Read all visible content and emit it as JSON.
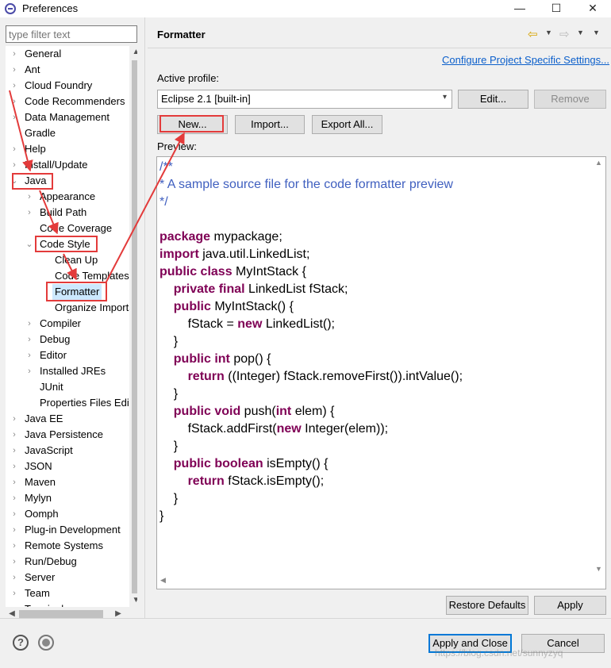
{
  "window": {
    "title": "Preferences",
    "app_icon": "eclipse-icon",
    "min": "—",
    "max": "☐",
    "close": "✕"
  },
  "filter": {
    "placeholder": "type filter text"
  },
  "tree": [
    {
      "label": "General",
      "level": 0,
      "arrow": "›"
    },
    {
      "label": "Ant",
      "level": 0,
      "arrow": "›"
    },
    {
      "label": "Cloud Foundry",
      "level": 0,
      "arrow": "›"
    },
    {
      "label": "Code Recommenders",
      "level": 0,
      "arrow": "›"
    },
    {
      "label": "Data Management",
      "level": 0,
      "arrow": "›"
    },
    {
      "label": "Gradle",
      "level": 0,
      "arrow": ""
    },
    {
      "label": "Help",
      "level": 0,
      "arrow": "›"
    },
    {
      "label": "Install/Update",
      "level": 0,
      "arrow": "›"
    },
    {
      "label": "Java",
      "level": 0,
      "arrow": "⌄"
    },
    {
      "label": "Appearance",
      "level": 1,
      "arrow": "›"
    },
    {
      "label": "Build Path",
      "level": 1,
      "arrow": "›"
    },
    {
      "label": "Code Coverage",
      "level": 1,
      "arrow": ""
    },
    {
      "label": "Code Style",
      "level": 1,
      "arrow": "⌄"
    },
    {
      "label": "Clean Up",
      "level": 2,
      "arrow": ""
    },
    {
      "label": "Code Templates",
      "level": 2,
      "arrow": ""
    },
    {
      "label": "Formatter",
      "level": 2,
      "arrow": "",
      "selected": true
    },
    {
      "label": "Organize Imports",
      "level": 2,
      "arrow": ""
    },
    {
      "label": "Compiler",
      "level": 1,
      "arrow": "›"
    },
    {
      "label": "Debug",
      "level": 1,
      "arrow": "›"
    },
    {
      "label": "Editor",
      "level": 1,
      "arrow": "›"
    },
    {
      "label": "Installed JREs",
      "level": 1,
      "arrow": "›"
    },
    {
      "label": "JUnit",
      "level": 1,
      "arrow": ""
    },
    {
      "label": "Properties Files Editor",
      "level": 1,
      "arrow": ""
    },
    {
      "label": "Java EE",
      "level": 0,
      "arrow": "›"
    },
    {
      "label": "Java Persistence",
      "level": 0,
      "arrow": "›"
    },
    {
      "label": "JavaScript",
      "level": 0,
      "arrow": "›"
    },
    {
      "label": "JSON",
      "level": 0,
      "arrow": "›"
    },
    {
      "label": "Maven",
      "level": 0,
      "arrow": "›"
    },
    {
      "label": "Mylyn",
      "level": 0,
      "arrow": "›"
    },
    {
      "label": "Oomph",
      "level": 0,
      "arrow": "›"
    },
    {
      "label": "Plug-in Development",
      "level": 0,
      "arrow": "›"
    },
    {
      "label": "Remote Systems",
      "level": 0,
      "arrow": "›"
    },
    {
      "label": "Run/Debug",
      "level": 0,
      "arrow": "›"
    },
    {
      "label": "Server",
      "level": 0,
      "arrow": "›"
    },
    {
      "label": "Team",
      "level": 0,
      "arrow": "›"
    },
    {
      "label": "Terminal",
      "level": 0,
      "arrow": "›"
    }
  ],
  "scroll": {
    "up": "▲",
    "down": "▼",
    "left": "◀",
    "right": "▶"
  },
  "page": {
    "title": "Formatter",
    "nav": {
      "back": "⇦",
      "forward": "⇨",
      "dropdown": "▼"
    },
    "configure_link": "Configure Project Specific Settings...",
    "profile_label": "Active profile:",
    "profile_value": "Eclipse 2.1 [built-in]",
    "profile_dd": "▾",
    "buttons": {
      "edit": "Edit...",
      "remove": "Remove",
      "new": "New...",
      "import": "Import...",
      "export_all": "Export All..."
    },
    "preview_label": "Preview:",
    "code": [
      [
        {
          "t": "/**",
          "s": "c"
        }
      ],
      [
        {
          "t": "* A sample source file for the code formatter preview",
          "s": "c"
        }
      ],
      [
        {
          "t": "*/",
          "s": "c"
        }
      ],
      [],
      [
        {
          "t": "package",
          "s": "k"
        },
        {
          "t": " mypackage;"
        }
      ],
      [
        {
          "t": "import",
          "s": "k"
        },
        {
          "t": " java.util.LinkedList;"
        }
      ],
      [
        {
          "t": "public class",
          "s": "k"
        },
        {
          "t": " MyIntStack {"
        }
      ],
      [
        {
          "t": "    "
        },
        {
          "t": "private final",
          "s": "k"
        },
        {
          "t": " LinkedList fStack;"
        }
      ],
      [
        {
          "t": "    "
        },
        {
          "t": "public",
          "s": "k"
        },
        {
          "t": " MyIntStack() {"
        }
      ],
      [
        {
          "t": "        fStack = "
        },
        {
          "t": "new",
          "s": "k"
        },
        {
          "t": " LinkedList();"
        }
      ],
      [
        {
          "t": "    }"
        }
      ],
      [
        {
          "t": "    "
        },
        {
          "t": "public int",
          "s": "k"
        },
        {
          "t": " pop() {"
        }
      ],
      [
        {
          "t": "        "
        },
        {
          "t": "return",
          "s": "k"
        },
        {
          "t": " ((Integer) fStack.removeFirst()).intValue();"
        }
      ],
      [
        {
          "t": "    }"
        }
      ],
      [
        {
          "t": "    "
        },
        {
          "t": "public void",
          "s": "k"
        },
        {
          "t": " push("
        },
        {
          "t": "int",
          "s": "k"
        },
        {
          "t": " elem) {"
        }
      ],
      [
        {
          "t": "        fStack.addFirst("
        },
        {
          "t": "new",
          "s": "k"
        },
        {
          "t": " Integer(elem));"
        }
      ],
      [
        {
          "t": "    }"
        }
      ],
      [
        {
          "t": "    "
        },
        {
          "t": "public boolean",
          "s": "k"
        },
        {
          "t": " isEmpty() {"
        }
      ],
      [
        {
          "t": "        "
        },
        {
          "t": "return",
          "s": "k"
        },
        {
          "t": " fStack.isEmpty();"
        }
      ],
      [
        {
          "t": "    }"
        }
      ],
      [
        {
          "t": "}"
        }
      ]
    ],
    "restore_defaults": "Restore Defaults",
    "apply": "Apply"
  },
  "footer": {
    "help": "?",
    "apply_close": "Apply and Close",
    "cancel": "Cancel"
  },
  "watermark": "https://blog.csdn.net/sunnyzyq",
  "colors": {
    "keyword": "#7f0055",
    "comment": "#3f5fbf",
    "link": "#0b5fcb",
    "annotation": "#e33b3b",
    "selection": "#cce8ff"
  }
}
